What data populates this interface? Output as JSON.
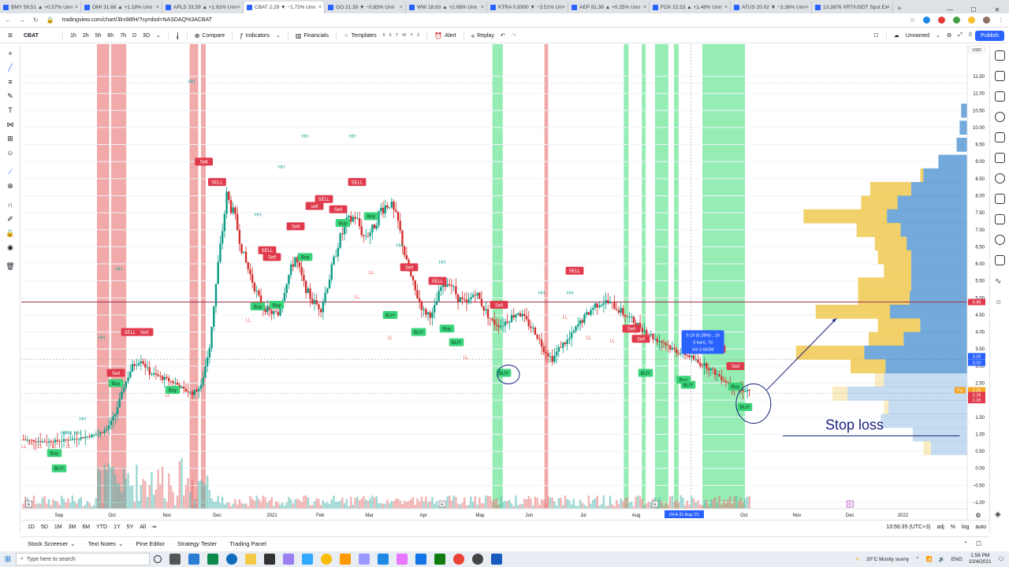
{
  "browser": {
    "tabs": [
      {
        "label": "BMY 59.51 ▲ +0.57% Unn",
        "active": false
      },
      {
        "label": "OMI 31.66 ▲ +1.18% Unn",
        "active": false
      },
      {
        "label": "APLS 33.59 ▲ +1.91% Unn",
        "active": false
      },
      {
        "label": "CBAT 2.29 ▼ −1.72% Unn",
        "active": true
      },
      {
        "label": "GO 21.39 ▼ −0.83% Unn",
        "active": false
      },
      {
        "label": "WW 18.63 ▲ +2.08% Unn",
        "active": false
      },
      {
        "label": "KTRA 0.8300 ▼ −3.51% Un",
        "active": false
      },
      {
        "label": "AEP 81.38 ▲ +0.25% Unn",
        "active": false
      },
      {
        "label": "FOX 22.53 ▲ +1.48% Unn",
        "active": false
      },
      {
        "label": "ATUS 20.02 ▼ −3.38% Unn",
        "active": false
      },
      {
        "label": "13.3876 XRT/USDT Spot Ex",
        "active": false
      }
    ],
    "new_tab": "+",
    "url": "tradingview.com/chart/3lrx98fH/?symbol=NASDAQ%3ACBAT"
  },
  "toolbar": {
    "symbol": "CBAT",
    "intervals": [
      "1h",
      "2h",
      "5h",
      "6h",
      "7h",
      "D",
      "3D"
    ],
    "compare": "Compare",
    "indicators": "Indicators",
    "financials": "Financials",
    "templates": "Templates",
    "template_letters": [
      "6",
      "6",
      "T",
      "W",
      "Y",
      "Z"
    ],
    "alert": "Alert",
    "replay": "Replay",
    "layout_name": "Unnamed",
    "publish": "Publish"
  },
  "chart_data": {
    "type": "candlestick",
    "symbol": "CBAT",
    "currency": "USD",
    "price_ticks": [
      "11.50",
      "11.00",
      "10.50",
      "10.00",
      "9.50",
      "9.00",
      "8.50",
      "8.00",
      "7.50",
      "7.00",
      "6.50",
      "6.00",
      "5.50",
      "5.00",
      "4.50",
      "4.00",
      "3.50",
      "3.00",
      "2.50",
      "2.00",
      "1.50",
      "1.00",
      "0.50",
      "0.00",
      "−0.50",
      "−1.00"
    ],
    "ylim": [
      -1.0,
      11.8
    ],
    "time_ticks": [
      "Sep",
      "Oct",
      "Nov",
      "Dec",
      "2021",
      "Feb",
      "Mar",
      "Apr",
      "May",
      "Jun",
      "Jul",
      "Aug",
      "Sep",
      "Oct",
      "Nov",
      "Dec",
      "2022"
    ],
    "price_path": [
      0.85,
      0.82,
      0.8,
      0.78,
      0.8,
      0.82,
      0.86,
      0.9,
      0.95,
      1.0,
      1.15,
      1.6,
      2.4,
      3.0,
      3.2,
      2.8,
      2.7,
      2.6,
      2.5,
      2.3,
      2.2,
      2.4,
      3.6,
      6.0,
      8.0,
      7.3,
      6.2,
      5.5,
      4.8,
      4.6,
      4.5,
      5.5,
      6.2,
      5.4,
      4.9,
      4.7,
      5.6,
      6.6,
      7.2,
      7.4,
      6.8,
      7.0,
      7.6,
      7.8,
      7.2,
      6.0,
      5.2,
      4.6,
      4.5,
      5.3,
      5.5,
      5.0,
      4.8,
      5.2,
      4.7,
      4.3,
      4.2,
      4.4,
      4.6,
      4.3,
      4.0,
      3.5,
      3.2,
      3.6,
      3.8,
      4.2,
      4.5,
      4.8,
      4.9,
      4.8,
      4.6,
      4.4,
      4.2,
      4.0,
      3.8,
      3.7,
      3.5,
      3.4,
      3.3,
      3.1,
      3.0,
      2.8,
      2.6,
      2.4,
      2.3,
      2.29
    ],
    "buy_signals": [
      {
        "label": "BUY",
        "t": 0.04,
        "p": 0.0
      },
      {
        "label": "Buy",
        "t": 0.035,
        "p": 0.45
      },
      {
        "label": "Buy",
        "t": 0.1,
        "p": 2.5
      },
      {
        "label": "Buy",
        "t": 0.16,
        "p": 2.3
      },
      {
        "label": "Buy",
        "t": 0.25,
        "p": 4.75
      },
      {
        "label": "Buy",
        "t": 0.27,
        "p": 4.8
      },
      {
        "label": "Buy",
        "t": 0.3,
        "p": 6.2
      },
      {
        "label": "Buy",
        "t": 0.34,
        "p": 7.2
      },
      {
        "label": "Buy",
        "t": 0.37,
        "p": 7.4
      },
      {
        "label": "BUY",
        "t": 0.39,
        "p": 4.5
      },
      {
        "label": "BUY",
        "t": 0.42,
        "p": 4.0
      },
      {
        "label": "Buy",
        "t": 0.45,
        "p": 4.1
      },
      {
        "label": "BUY",
        "t": 0.46,
        "p": 3.7
      },
      {
        "label": "BUY",
        "t": 0.51,
        "p": 2.8
      },
      {
        "label": "BUY",
        "t": 0.66,
        "p": 2.8
      },
      {
        "label": "Buy",
        "t": 0.7,
        "p": 2.6
      },
      {
        "label": "BUY",
        "t": 0.705,
        "p": 2.45
      },
      {
        "label": "Buy",
        "t": 0.755,
        "p": 2.4
      },
      {
        "label": "BUY",
        "t": 0.765,
        "p": 1.8
      }
    ],
    "sell_signals": [
      {
        "label": "Sell",
        "t": 0.193,
        "p": 9.0
      },
      {
        "label": "SELL",
        "t": 0.207,
        "p": 8.4
      },
      {
        "label": "SELL",
        "t": 0.115,
        "p": 4.0
      },
      {
        "label": "Sell",
        "t": 0.13,
        "p": 4.0
      },
      {
        "label": "Sell",
        "t": 0.1,
        "p": 2.8
      },
      {
        "label": "SELL",
        "t": 0.26,
        "p": 6.4
      },
      {
        "label": "Sell",
        "t": 0.265,
        "p": 6.2
      },
      {
        "label": "Sell",
        "t": 0.29,
        "p": 7.1
      },
      {
        "label": "sell",
        "t": 0.31,
        "p": 7.7
      },
      {
        "label": "SELL",
        "t": 0.32,
        "p": 7.9
      },
      {
        "label": "Sell",
        "t": 0.335,
        "p": 7.6
      },
      {
        "label": "SELL",
        "t": 0.355,
        "p": 8.4
      },
      {
        "label": "Sell",
        "t": 0.41,
        "p": 5.9
      },
      {
        "label": "SELL",
        "t": 0.44,
        "p": 5.5
      },
      {
        "label": "Sell",
        "t": 0.505,
        "p": 4.8
      },
      {
        "label": "SELL",
        "t": 0.585,
        "p": 5.8
      },
      {
        "label": "Sell",
        "t": 0.645,
        "p": 4.1
      },
      {
        "label": "Sell",
        "t": 0.655,
        "p": 3.8
      },
      {
        "label": "SELL",
        "t": 0.735,
        "p": 3.5
      },
      {
        "label": "Sell",
        "t": 0.755,
        "p": 3.0
      }
    ],
    "hh_labels": [
      {
        "t": 0.045,
        "p": 1.0
      },
      {
        "t": 0.05,
        "p": 1.0
      },
      {
        "t": 0.06,
        "p": 1.0
      },
      {
        "t": 0.065,
        "p": 1.4
      },
      {
        "t": 0.085,
        "p": 3.8
      },
      {
        "t": 0.103,
        "p": 5.8
      },
      {
        "t": 0.18,
        "p": 11.3
      },
      {
        "t": 0.25,
        "p": 7.4
      },
      {
        "t": 0.275,
        "p": 8.8
      },
      {
        "t": 0.3,
        "p": 9.7
      },
      {
        "t": 0.35,
        "p": 9.7
      },
      {
        "t": 0.4,
        "p": 6.5
      },
      {
        "t": 0.445,
        "p": 6.0
      },
      {
        "t": 0.55,
        "p": 5.1
      },
      {
        "t": 0.58,
        "p": 5.1
      }
    ],
    "ll_labels": [
      {
        "t": 0.003,
        "p": 0.6
      },
      {
        "t": 0.01,
        "p": 0.7
      },
      {
        "t": 0.02,
        "p": 0.6
      },
      {
        "t": 0.035,
        "p": 0.6
      },
      {
        "t": 0.05,
        "p": 0.6
      },
      {
        "t": 0.155,
        "p": 2.1
      },
      {
        "t": 0.24,
        "p": 4.3
      },
      {
        "t": 0.26,
        "p": 4.5
      },
      {
        "t": 0.355,
        "p": 5.0
      },
      {
        "t": 0.37,
        "p": 5.7
      },
      {
        "t": 0.39,
        "p": 3.8
      },
      {
        "t": 0.47,
        "p": 3.2
      },
      {
        "t": 0.575,
        "p": 4.4
      },
      {
        "t": 0.6,
        "p": 3.8
      },
      {
        "t": 0.625,
        "p": 3.7
      }
    ],
    "red_zones": [
      [
        0.08,
        0.093
      ],
      [
        0.095,
        0.111
      ],
      [
        0.178,
        0.187
      ],
      [
        0.19,
        0.195
      ],
      [
        0.553,
        0.557
      ]
    ],
    "green_zones": [
      [
        0.498,
        0.509
      ],
      [
        0.637,
        0.642
      ],
      [
        0.656,
        0.66
      ],
      [
        0.67,
        0.684
      ],
      [
        0.69,
        0.695
      ],
      [
        0.72,
        0.765
      ]
    ],
    "volume_profile": [
      {
        "p": 10.5,
        "up": 0.0,
        "down": 0.04
      },
      {
        "p": 10.0,
        "up": 0.0,
        "down": 0.05
      },
      {
        "p": 9.5,
        "up": 0.0,
        "down": 0.07
      },
      {
        "p": 9.0,
        "up": 0.0,
        "down": 0.19
      },
      {
        "p": 8.6,
        "up": 0.02,
        "down": 0.29
      },
      {
        "p": 8.2,
        "up": 0.27,
        "down": 0.37
      },
      {
        "p": 7.8,
        "up": 0.24,
        "down": 0.46
      },
      {
        "p": 7.4,
        "up": 0.55,
        "down": 0.53
      },
      {
        "p": 7.0,
        "up": 0.29,
        "down": 0.44
      },
      {
        "p": 6.6,
        "up": 0.21,
        "down": 0.4
      },
      {
        "p": 6.2,
        "up": 0.22,
        "down": 0.37
      },
      {
        "p": 5.8,
        "up": 0.18,
        "down": 0.37
      },
      {
        "p": 5.4,
        "up": 0.35,
        "down": 0.37
      },
      {
        "p": 5.0,
        "up": 0.34,
        "down": 0.38
      },
      {
        "p": 4.6,
        "up": 0.49,
        "down": 0.51
      },
      {
        "p": 4.2,
        "up": 0.28,
        "down": 0.31
      },
      {
        "p": 3.8,
        "up": 0.23,
        "down": 0.42
      },
      {
        "p": 3.4,
        "up": 0.45,
        "down": 0.68
      },
      {
        "p": 3.0,
        "up": 0.23,
        "down": 0.54
      },
      {
        "p": 2.6,
        "up": 0.06,
        "down": 0.55
      },
      {
        "p": 2.2,
        "up": 0.1,
        "down": 0.79
      },
      {
        "p": 1.8,
        "up": 0.03,
        "down": 0.52
      },
      {
        "p": 1.4,
        "up": 0.0,
        "down": 0.57
      },
      {
        "p": 1.0,
        "up": 0.0,
        "down": 0.36
      },
      {
        "p": 0.6,
        "up": 0.05,
        "down": 0.24
      }
    ],
    "resistance_level": 4.88,
    "stop_loss_level": 1.0,
    "stop_loss_label": "Stop loss",
    "price_labels": [
      {
        "text": "4.88",
        "p": 4.88,
        "color": "#e03a4c"
      },
      {
        "text": "3.29",
        "p": 3.29,
        "color": "#2962ff"
      },
      {
        "text": "3.10",
        "p": 3.1,
        "color": "#2962ff"
      },
      {
        "text": "2.29",
        "p": 2.29,
        "color": "#f5a623"
      },
      {
        "text": "2.29",
        "p": 2.15,
        "color": "#e03a4c"
      },
      {
        "text": "2.28",
        "p": 2.0,
        "color": "#e03a4c"
      }
    ],
    "pre_label": "Pre",
    "currency_label": "USD",
    "measure_tooltip": {
      "line1": "0.19 (6.28%) , 19",
      "line2": "5 bars, 7d",
      "line3": "Vol 3.662M"
    },
    "time_range_label": "24 A   31 Aug '21",
    "colors": {
      "up": "#26a69a",
      "down": "#ef5350",
      "buy": "#3ad37a",
      "sell": "#e03a4c",
      "vp_up": "#f0c850",
      "vp_down": "#5b9bd5"
    }
  },
  "timeframes": [
    "1D",
    "5D",
    "1M",
    "3M",
    "6M",
    "YTD",
    "1Y",
    "5Y",
    "All"
  ],
  "clock_utc": "13:56:35 (UTC+3)",
  "scale_options": [
    "adj",
    "%",
    "log",
    "auto"
  ],
  "panel_tabs": [
    "Stock Screener",
    "Text Notes",
    "Pine Editor",
    "Strategy Tester",
    "Trading Panel"
  ],
  "taskbar": {
    "search_placeholder": "Type here to search",
    "weather": "20°C  Mostly sunny",
    "lang": "ENG",
    "time": "1:56 PM",
    "date": "10/4/2021"
  }
}
